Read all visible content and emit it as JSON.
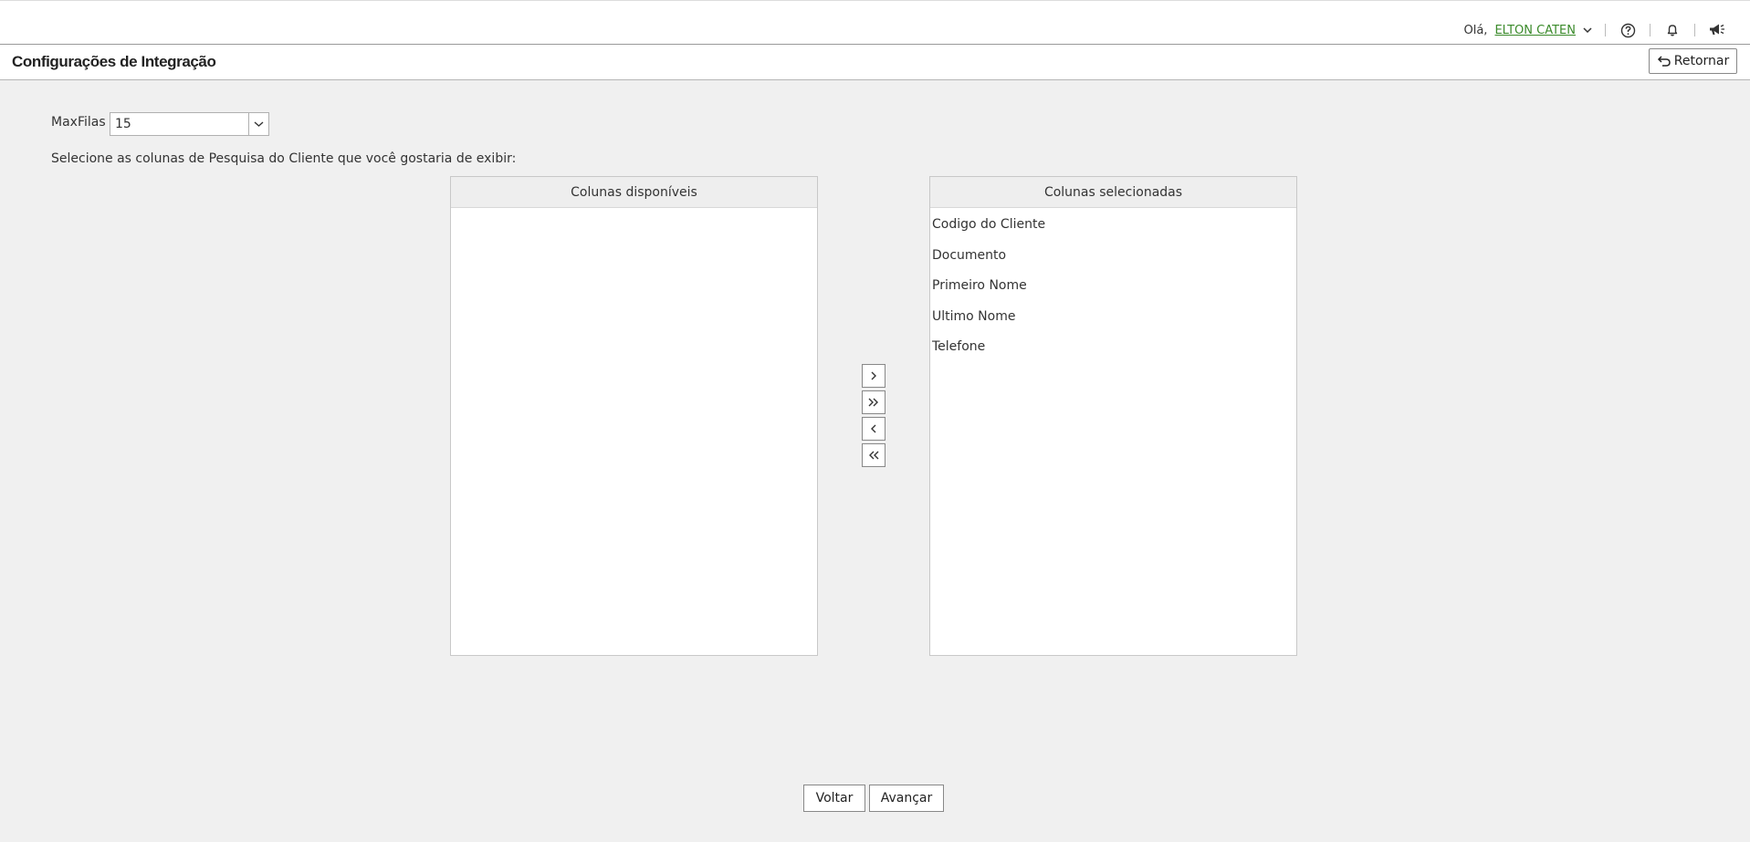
{
  "header": {
    "greeting": "Olá,",
    "user_name": "ELTON CATEN",
    "icons": [
      "chevron-down-icon",
      "help-icon",
      "bell-icon",
      "megaphone-icon"
    ]
  },
  "page": {
    "title": "Configurações de Integração",
    "return_label": "Retornar"
  },
  "form": {
    "maxfilas_label": "MaxFilas",
    "maxfilas_value": "15",
    "instruction": "Selecione as colunas de Pesquisa do Cliente que você gostaria de exibir:"
  },
  "lists": {
    "available": {
      "header": "Colunas disponíveis",
      "items": []
    },
    "selected": {
      "header": "Colunas selecionadas",
      "items": [
        "Codigo do Cliente",
        "Documento",
        "Primeiro Nome",
        "Ultimo Nome",
        "Telefone"
      ]
    }
  },
  "movers": [
    {
      "name": "move-right-button",
      "icon": "chevron-right-icon"
    },
    {
      "name": "move-all-right-button",
      "icon": "double-chevron-right-icon"
    },
    {
      "name": "move-left-button",
      "icon": "chevron-left-icon"
    },
    {
      "name": "move-all-left-button",
      "icon": "double-chevron-left-icon"
    }
  ],
  "footer": {
    "back_label": "Voltar",
    "next_label": "Avançar"
  },
  "colors": {
    "link": "#3a8a2a",
    "background": "#f0f0f0"
  }
}
